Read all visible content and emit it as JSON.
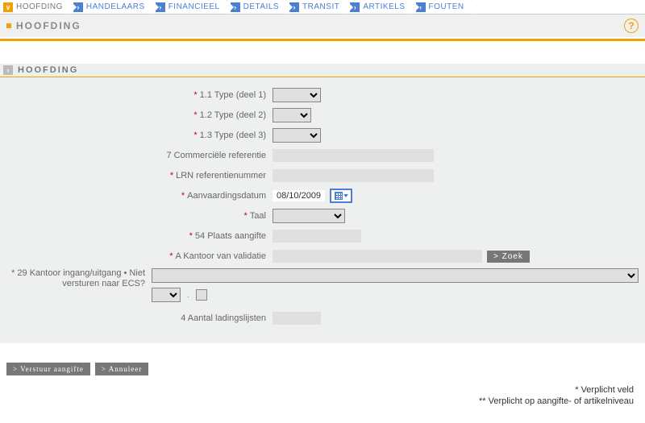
{
  "tabs": [
    {
      "label": "HOOFDING",
      "active": true
    },
    {
      "label": "HANDELAARS",
      "active": false
    },
    {
      "label": "FINANCIEEL",
      "active": false
    },
    {
      "label": "DETAILS",
      "active": false
    },
    {
      "label": "TRANSIT",
      "active": false
    },
    {
      "label": "ARTIKELS",
      "active": false
    },
    {
      "label": "FOUTEN",
      "active": false
    }
  ],
  "page_title": "HOOFDING",
  "section_title": "HOOFDING",
  "fields": {
    "type1": {
      "label": "1.1 Type (deel 1)",
      "required": true
    },
    "type2": {
      "label": "1.2 Type (deel 2)",
      "required": true
    },
    "type3": {
      "label": "1.3 Type (deel 3)",
      "required": true
    },
    "comref": {
      "label": "7 Commerciële referentie",
      "required": false
    },
    "lrn": {
      "label": "LRN referentienummer",
      "required": true
    },
    "date": {
      "label": "Aanvaardingsdatum",
      "required": true,
      "value": "08/10/2009"
    },
    "taal": {
      "label": "Taal",
      "required": true
    },
    "plaats": {
      "label": "54 Plaats aangifte",
      "required": true
    },
    "kantoor": {
      "label": "A Kantoor van validatie",
      "required": true,
      "zoek": "Zoek"
    },
    "k29": {
      "label": "29 Kantoor ingang/uitgang • Niet versturen naar ECS?",
      "required": true
    },
    "lading": {
      "label": "4 Aantal ladingslijsten",
      "required": false
    }
  },
  "buttons": {
    "submit": "Verstuur aangifte",
    "cancel": "Annuleer"
  },
  "footnotes": {
    "l1": "* Verplicht veld",
    "l2": "** Verplicht op aangifte- of artikelniveau"
  }
}
